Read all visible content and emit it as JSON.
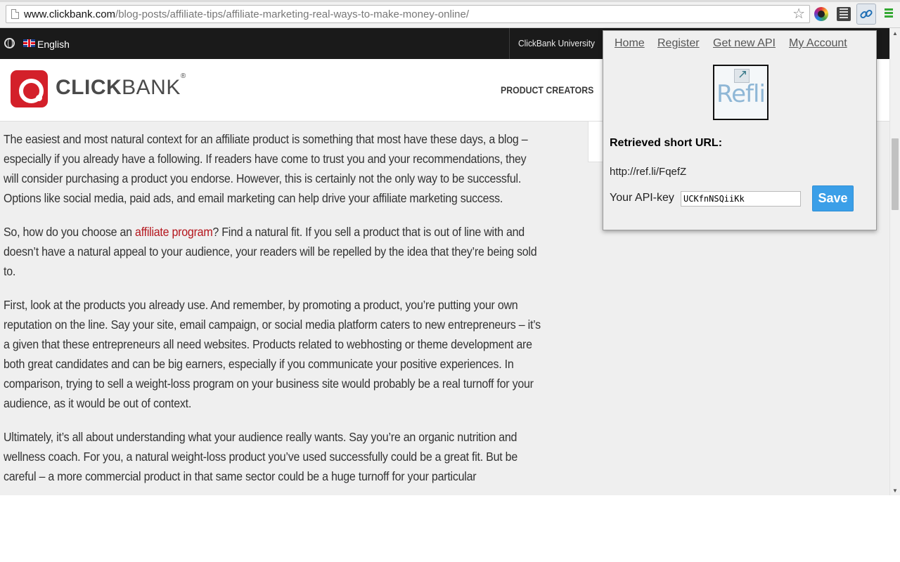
{
  "browser": {
    "url_domain": "www.clickbank.com",
    "url_path": "/blog-posts/affiliate-tips/affiliate-marketing-real-ways-to-make-money-online/"
  },
  "topbar": {
    "language": "English",
    "university_link": "ClickBank University"
  },
  "header": {
    "logo_bold": "CLICK",
    "logo_light": "BANK",
    "logo_mark": "®",
    "nav_product_creators": "PRODUCT CREATORS"
  },
  "article": {
    "p1": "The easiest and most natural context for an affiliate product is something that most have these days, a blog – especially if you already have a following. If readers have come to trust you and your recommendations, they will consider purchasing a product you endorse. However, this is certainly not the only way to be successful. Options like social media, paid ads, and email marketing can help drive your affiliate marketing success.",
    "p2_before": "So, how do you choose an ",
    "p2_link": "affiliate program",
    "p2_after": "? Find a natural fit. If you sell a product that is out of line with and doesn’t have a natural appeal to your audience, your readers will be repelled by the idea that they’re being sold to.",
    "p3": "First, look at the products you already use. And remember, by promoting a product, you’re putting your own reputation on the line. Say your site, email campaign, or social media platform caters to new entrepreneurs – it’s a given that these entrepreneurs all need websites. Products related to webhosting or theme development are both great candidates and can be big earners, especially if you communicate your positive experiences. In comparison, trying to sell a weight-loss program on your business site would probably be a real turnoff for your audience, as it would be out of context.",
    "p4": "Ultimately, it’s all about understanding what your audience really wants. Say you’re an organic nutrition and wellness coach. For you, a natural weight-loss product you’ve used successfully could be a great fit. But be careful – a more commercial product in that same sector could be a huge turnoff for your particular"
  },
  "popup": {
    "nav": {
      "home": "Home",
      "register": "Register",
      "get_api": "Get new API",
      "account": "My Account"
    },
    "logo_text": "Refli",
    "short_url_label": "Retrieved short URL:",
    "short_url": "http://ref.li/FqefZ",
    "api_label": "Your API-key",
    "api_value": "UCKfnNSQiiKk",
    "save_label": "Save"
  },
  "colors": {
    "brand_red": "#d3202a",
    "link_red": "#b4161d",
    "save_blue": "#3b9fe8"
  }
}
